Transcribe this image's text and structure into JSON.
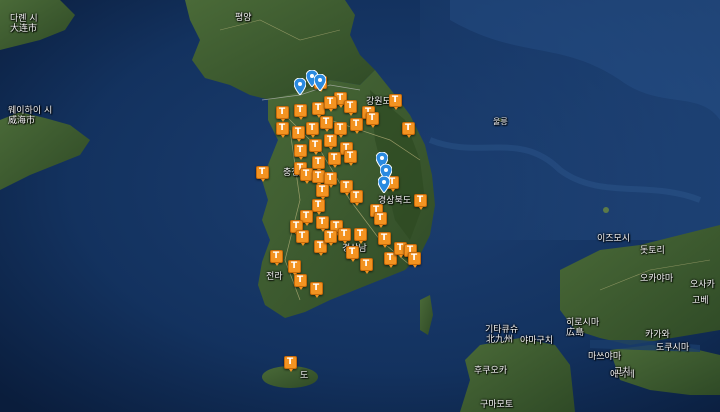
{
  "map": {
    "labels": [
      {
        "id": "dalian",
        "text": "다롄 시",
        "sub": "大连市"
      },
      {
        "id": "pyongyang",
        "text": "평양"
      },
      {
        "id": "weihai",
        "text": "웨이하이 시",
        "sub": "威海市"
      },
      {
        "id": "gangwon",
        "text": "강원도"
      },
      {
        "id": "chungcheong",
        "text": "충청"
      },
      {
        "id": "gyeongbuk",
        "text": "경상북도"
      },
      {
        "id": "gyeongnam",
        "text": "경상남"
      },
      {
        "id": "jeolla",
        "text": "전라"
      },
      {
        "id": "jeju",
        "text": "도"
      },
      {
        "id": "ulleung",
        "text": "울릉"
      },
      {
        "id": "izumo",
        "text": "이즈모시"
      },
      {
        "id": "tottori",
        "text": "돗토리"
      },
      {
        "id": "okayama",
        "text": "오카야마"
      },
      {
        "id": "bukucho",
        "text": "北九州"
      },
      {
        "id": "hiroshima",
        "text": "히로시마"
      },
      {
        "id": "hiroshima_jp",
        "text": "広島"
      },
      {
        "id": "kitakyushu",
        "text": "기타큐슈"
      },
      {
        "id": "fukuoka",
        "text": "후쿠오카"
      },
      {
        "id": "kumamoto",
        "text": "구마모토"
      },
      {
        "id": "yamaguchi",
        "text": "야마구치"
      },
      {
        "id": "matsuyama",
        "text": "마쓰야마"
      },
      {
        "id": "ehime",
        "text": "에히메"
      },
      {
        "id": "kagawa",
        "text": "카가와"
      },
      {
        "id": "tokushima",
        "text": "도쿠시마"
      },
      {
        "id": "kochi",
        "text": "고치"
      },
      {
        "id": "kobe",
        "text": "고베"
      },
      {
        "id": "osaka",
        "text": "오사카"
      }
    ],
    "marker_symbol": "T",
    "colors": {
      "sea": "#0d2a52",
      "land": "#3c5a2e",
      "marker_orange": "#f39321",
      "pin_blue": "#2a8ae0"
    }
  }
}
